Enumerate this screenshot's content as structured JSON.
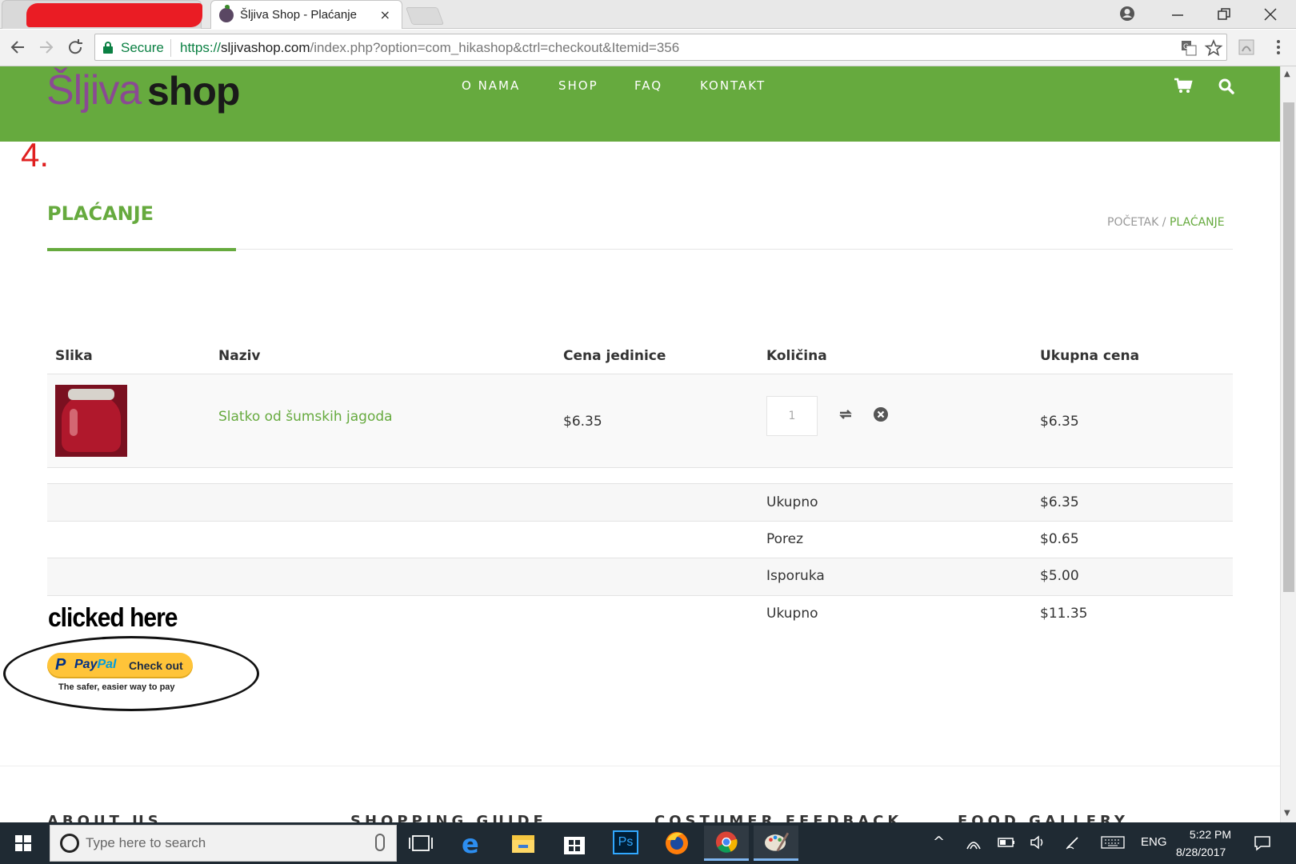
{
  "browser": {
    "tabs": [
      {
        "label": ""
      },
      {
        "label": "Šljiva Shop - Plaćanje"
      }
    ],
    "close_glyph": "×",
    "omnibox": {
      "secure_label": "Secure",
      "url_protocol": "https://",
      "url_host": "sljivashop.com",
      "url_path": "/index.php?option=com_hikashop&ctrl=checkout&Itemid=356"
    },
    "icons": [
      "back-icon",
      "forward-icon",
      "reload-icon",
      "lock-icon",
      "translate-icon",
      "star-icon",
      "pdf-extension-icon",
      "menu-icon",
      "profile-icon",
      "minimize-icon",
      "restore-icon",
      "close-icon"
    ]
  },
  "site": {
    "logo": {
      "part1": "Šljiva",
      "part2": "shop"
    },
    "nav": [
      "O NAMA",
      "SHOP",
      "FAQ",
      "KONTAKT"
    ],
    "brand_color": "#66aa3e"
  },
  "annotations": {
    "step": "4.",
    "note": "clicked here"
  },
  "page": {
    "title": "PLAĆANJE",
    "breadcrumb": {
      "home": "POČETAK",
      "separator": "/",
      "current": "PLAĆANJE"
    }
  },
  "cart": {
    "columns": [
      "Slika",
      "Naziv",
      "Cena jedinice",
      "Količina",
      "Ukupna cena"
    ],
    "items": [
      {
        "name": "Slatko od šumskih jagoda",
        "unit_price": "$6.35",
        "quantity": "1",
        "total": "$6.35"
      }
    ],
    "summary": [
      {
        "label": "Ukupno",
        "value": "$6.35"
      },
      {
        "label": "Porez",
        "value": "$0.65"
      },
      {
        "label": "Isporuka",
        "value": "$5.00"
      },
      {
        "label": "Ukupno",
        "value": "$11.35"
      }
    ]
  },
  "paypal": {
    "p": "P",
    "pay": "Pay",
    "pal": "Pal",
    "button_label": "Check out",
    "tagline": "The safer, easier way to pay"
  },
  "footer": {
    "headings": [
      "ABOUT US",
      "SHOPPING GUIDE",
      "COSTUMER FEEDBACK",
      "FOOD GALLERY"
    ]
  },
  "taskbar": {
    "search_placeholder": "Type here to search",
    "language": "ENG",
    "time": "5:22 PM",
    "date": "8/28/2017",
    "apps": [
      "task-view-icon",
      "edge-icon",
      "file-explorer-icon",
      "store-icon",
      "photoshop-icon",
      "firefox-icon",
      "chrome-icon",
      "paint-icon"
    ],
    "photoshop_label": "Ps"
  }
}
